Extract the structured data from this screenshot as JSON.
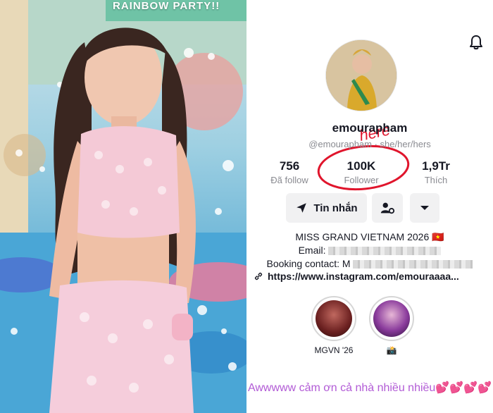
{
  "photo": {
    "banner_text": "RAINBOW PARTY!!"
  },
  "profile": {
    "notification_icon": "bell-icon",
    "username": "emourapham",
    "handle_and_pronouns": "@emourapham · she/her/hers",
    "annotation_text": "here",
    "stats": {
      "following": {
        "value": "756",
        "label": "Đã follow"
      },
      "followers": {
        "value": "100K",
        "label": "Follower"
      },
      "likes": {
        "value": "1,9Tr",
        "label": "Thích"
      }
    },
    "buttons": {
      "message_label": "Tin nhắn",
      "message_icon": "send-icon",
      "add_friend_icon": "person-settings-icon",
      "more_icon": "chevron-down-icon"
    },
    "bio": {
      "title": "MISS GRAND VIETNAM 2026 🇻🇳",
      "email_label": "Email:",
      "booking_label": "Booking contact: M"
    },
    "link": {
      "icon": "link-icon",
      "text": "https://www.instagram.com/emouraaaa..."
    },
    "highlights": [
      {
        "caption": "MGVN '26"
      },
      {
        "caption": "📸"
      }
    ],
    "caption": "Awwwww cảm ơn cả nhà nhiều nhiều💕💕💕💕"
  },
  "colors": {
    "annotation_red": "#e0152c",
    "caption_purple": "#b25bd6"
  }
}
